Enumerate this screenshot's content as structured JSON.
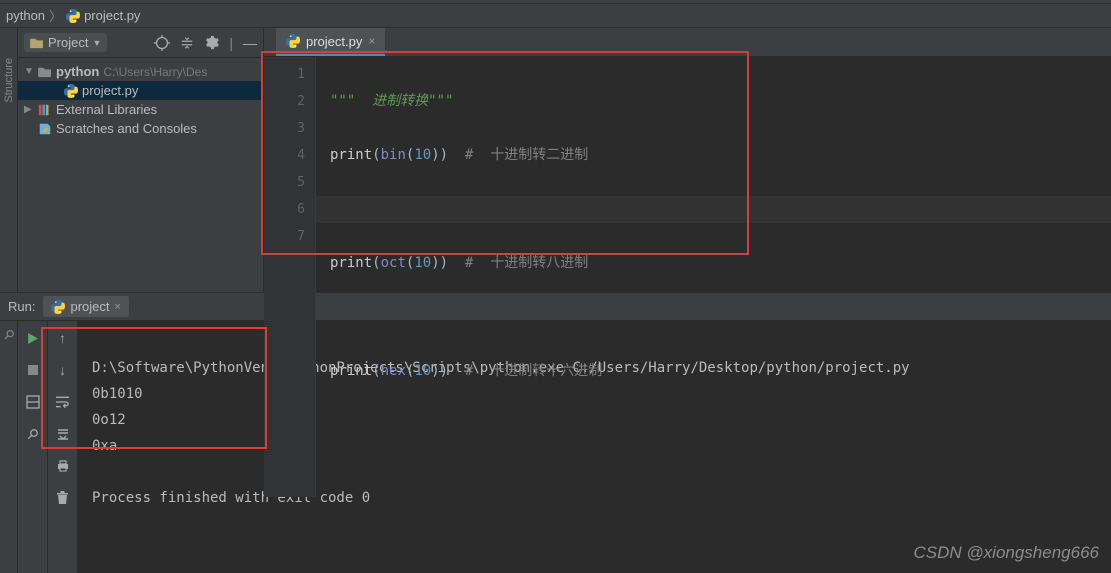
{
  "breadcrumb": {
    "root": "python",
    "file": "project.py"
  },
  "project_panel": {
    "button_label": "Project",
    "root_name": "python",
    "root_path": "C:\\Users\\Harry\\Des",
    "file": "project.py",
    "ext_libs": "External Libraries",
    "scratches": "Scratches and Consoles"
  },
  "sidebar": {
    "structure_label": "Structure"
  },
  "editor": {
    "tab_label": "project.py",
    "lines": [
      "1",
      "2",
      "3",
      "4",
      "5",
      "6",
      "7"
    ],
    "l1_a": "\"\"\"",
    "l1_b": "  进制转换",
    "l1_c": "\"\"\"",
    "l2_func": "print",
    "l2_p1": "(",
    "l2_builtin": "bin",
    "l2_p2": "(",
    "l2_num": "10",
    "l2_p3": "))",
    "l2_comment": "  #  十进制转二进制",
    "l4_func": "print",
    "l4_p1": "(",
    "l4_builtin": "oct",
    "l4_p2": "(",
    "l4_num": "10",
    "l4_p3": "))",
    "l4_comment": "  #  十进制转八进制",
    "l6_func": "print",
    "l6_p1": "(",
    "l6_builtin": "hex",
    "l6_p2": "(",
    "l6_num": "10",
    "l6_p3": "))",
    "l6_comment": "  #  十进制转十六进制"
  },
  "run": {
    "label": "Run:",
    "tab": "project",
    "out_cmd": "D:\\Software\\PythonVenv\\PythonProjects\\Scripts\\python.exe C:/Users/Harry/Desktop/python/project.py",
    "out1": "0b1010",
    "out2": "0o12",
    "out3": "0xa",
    "out_end": "Process finished with exit code 0"
  },
  "watermark": "CSDN @xiongsheng666"
}
